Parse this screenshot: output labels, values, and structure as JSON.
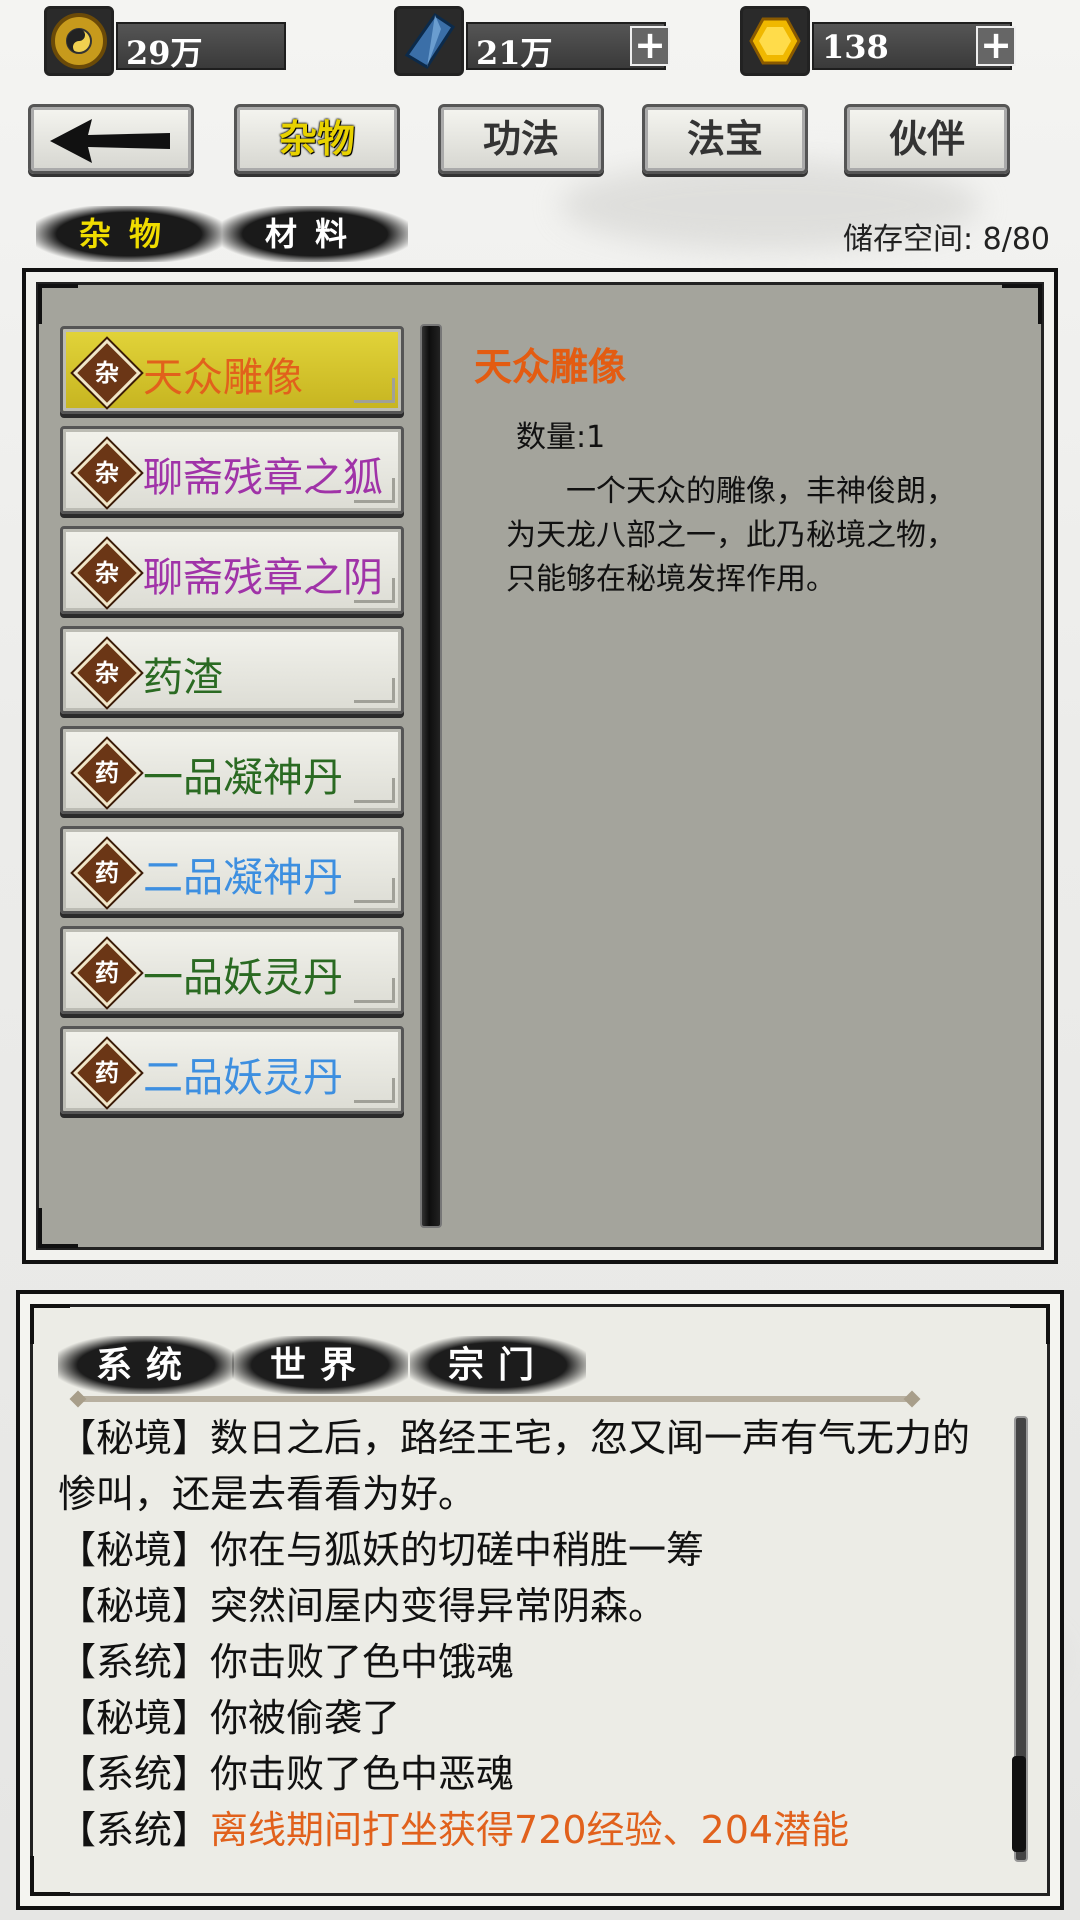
{
  "resources": [
    {
      "icon": "yin-yang-coin-icon",
      "value": "29万",
      "has_plus": false
    },
    {
      "icon": "blue-crystal-icon",
      "value": "21万",
      "has_plus": true
    },
    {
      "icon": "gold-gem-icon",
      "value": "138",
      "has_plus": true
    }
  ],
  "nav": {
    "back_icon": "back-arrow-icon",
    "tabs": [
      "杂物",
      "功法",
      "法宝",
      "伙伴"
    ],
    "active_tab": "杂物"
  },
  "subtabs": [
    "杂物",
    "材料"
  ],
  "storage_label": "储存空间: 8/80",
  "items": [
    {
      "badge": "杂",
      "name": "天众雕像",
      "color": "#e1611c",
      "selected": true
    },
    {
      "badge": "杂",
      "name": "聊斋残章之狐",
      "color": "#a033a8",
      "selected": false
    },
    {
      "badge": "杂",
      "name": "聊斋残章之阴",
      "color": "#a033a8",
      "selected": false
    },
    {
      "badge": "杂",
      "name": "药渣",
      "color": "#2a6a22",
      "selected": false
    },
    {
      "badge": "药",
      "name": "一品凝神丹",
      "color": "#2a6a22",
      "selected": false
    },
    {
      "badge": "药",
      "name": "二品凝神丹",
      "color": "#3d8fe0",
      "selected": false
    },
    {
      "badge": "药",
      "name": "一品妖灵丹",
      "color": "#2a6a22",
      "selected": false
    },
    {
      "badge": "药",
      "name": "二品妖灵丹",
      "color": "#3d8fe0",
      "selected": false
    }
  ],
  "detail": {
    "title": "天众雕像",
    "quantity": "数量:1",
    "description": "一个天众的雕像，丰神俊朗，为天龙八部之一，此乃秘境之物，只能够在秘境发挥作用。"
  },
  "chat": {
    "tabs": [
      "系统",
      "世界",
      "宗门"
    ],
    "messages": [
      {
        "tag": "【秘境】",
        "text": "数日之后，路经王宅，忽又闻一声有气无力的惨叫，还是去看看为好。",
        "highlight": false
      },
      {
        "tag": "【秘境】",
        "text": "你在与狐妖的切磋中稍胜一筹",
        "highlight": false
      },
      {
        "tag": "【秘境】",
        "text": "突然间屋内变得异常阴森。",
        "highlight": false
      },
      {
        "tag": "【系统】",
        "text": "你击败了色中饿魂",
        "highlight": false
      },
      {
        "tag": "【秘境】",
        "text": "你被偷袭了",
        "highlight": false
      },
      {
        "tag": "【系统】",
        "text": "你击败了色中恶魂",
        "highlight": false
      },
      {
        "tag": "【系统】",
        "text": "离线期间打坐获得720经验、204潜能",
        "highlight": true
      }
    ]
  }
}
